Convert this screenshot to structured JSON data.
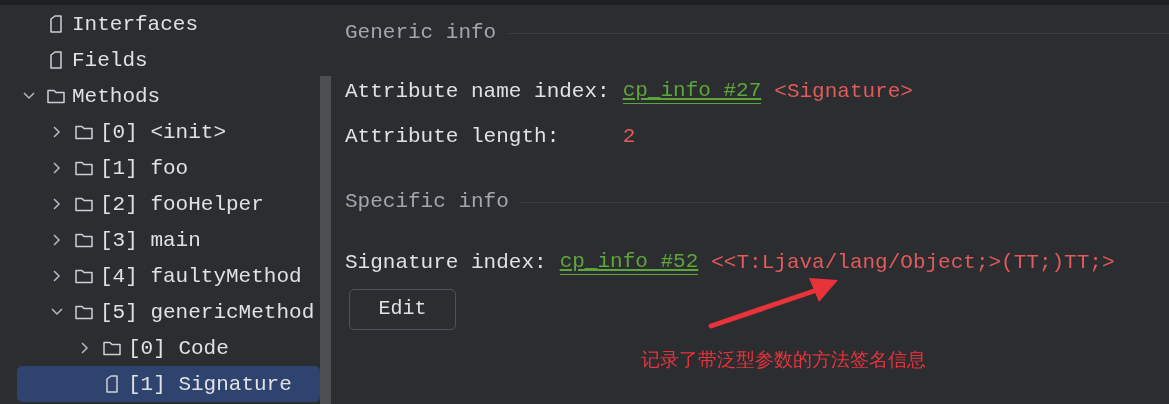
{
  "tree": [
    {
      "kind": "file",
      "label": "Interfaces",
      "selected": false
    },
    {
      "kind": "file",
      "label": "Fields",
      "selected": false
    },
    {
      "kind": "folder",
      "label": "Methods",
      "selected": false,
      "expanded": true,
      "children": [
        {
          "kind": "folder",
          "label": "[0] <init>",
          "selected": false,
          "expanded": false
        },
        {
          "kind": "folder",
          "label": "[1] foo",
          "selected": false,
          "expanded": false
        },
        {
          "kind": "folder",
          "label": "[2] fooHelper",
          "selected": false,
          "expanded": false
        },
        {
          "kind": "folder",
          "label": "[3] main",
          "selected": false,
          "expanded": false
        },
        {
          "kind": "folder",
          "label": "[4] faultyMethod",
          "selected": false,
          "expanded": false
        },
        {
          "kind": "folder",
          "label": "[5] genericMethod",
          "selected": false,
          "expanded": true,
          "children": [
            {
              "kind": "folder",
              "label": "[0] Code",
              "selected": false,
              "expanded": false
            },
            {
              "kind": "file",
              "label": "[1] Signature",
              "selected": true
            }
          ]
        }
      ]
    }
  ],
  "generic_info": {
    "title": "Generic info",
    "rows": [
      {
        "label": "Attribute name index:",
        "link": "cp_info #27",
        "value": "<Signature>"
      },
      {
        "label": "Attribute length:",
        "value": "2"
      }
    ]
  },
  "specific_info": {
    "title": "Specific info",
    "rows": [
      {
        "label": "Signature index:",
        "link": "cp_info #52",
        "value": "<<T:Ljava/lang/Object;>(TT;)TT;>"
      }
    ]
  },
  "edit_button": "Edit",
  "annotation": {
    "text": "记录了带泛型参数的方法签名信息"
  }
}
